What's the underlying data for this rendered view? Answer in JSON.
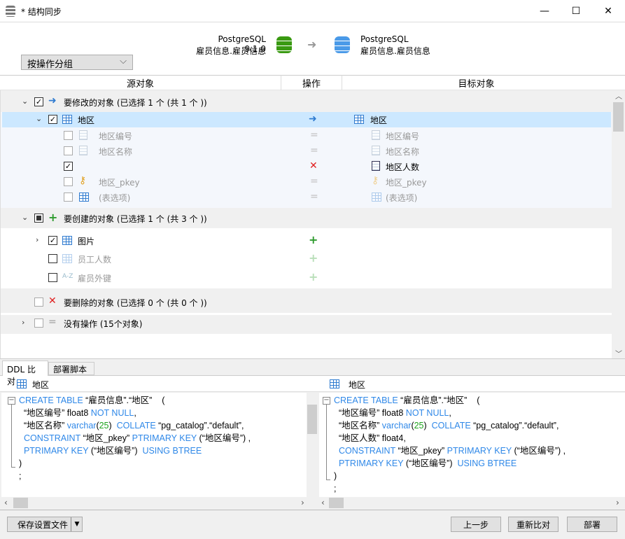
{
  "window": {
    "title": "* 结构同步",
    "min": "—",
    "max": "☐",
    "close": "✕"
  },
  "header": {
    "source_version": "PostgreSQL 9.1.0",
    "source_schema": "雇员信息.雇员信息",
    "target_version": "PostgreSQL",
    "target_schema": "雇员信息.雇员信息",
    "arrow": "➜"
  },
  "group_select": {
    "value": "按操作分组",
    "chevron": "⌵"
  },
  "columns": {
    "source": "源对象",
    "action": "操作",
    "target": "目标对象"
  },
  "tree": {
    "modify_group": "要修改的对象 (已选择 1 个 (共 1 个 ))",
    "modify_table": "地区",
    "modify_target": "地区",
    "fields": [
      {
        "src": "地区编号",
        "dst": "地区编号",
        "op": "="
      },
      {
        "src": "地区名称",
        "dst": "地区名称",
        "op": "="
      },
      {
        "src": "",
        "dst": "地区人数",
        "op": "✕"
      },
      {
        "src": "地区_pkey",
        "dst": "地区_pkey",
        "op": "="
      },
      {
        "src": "(表选项)",
        "dst": "(表选项)",
        "op": "="
      }
    ],
    "create_group": "要创建的对象 (已选择 1 个 (共 3 个 ))",
    "create_items": [
      "图片",
      "员工人数",
      "雇员外键"
    ],
    "delete_group": "要删除的对象 (已选择 0 个 (共 0 个 ))",
    "none_group": "没有操作 (15个对象)"
  },
  "tabs": [
    "DDL 比对",
    "部署脚本"
  ],
  "ddl": {
    "left_title": "地区",
    "right_title": "地区"
  },
  "footer": {
    "save": "保存设置文件",
    "prev": "上一步",
    "recompare": "重新比对",
    "deploy": "部署"
  }
}
